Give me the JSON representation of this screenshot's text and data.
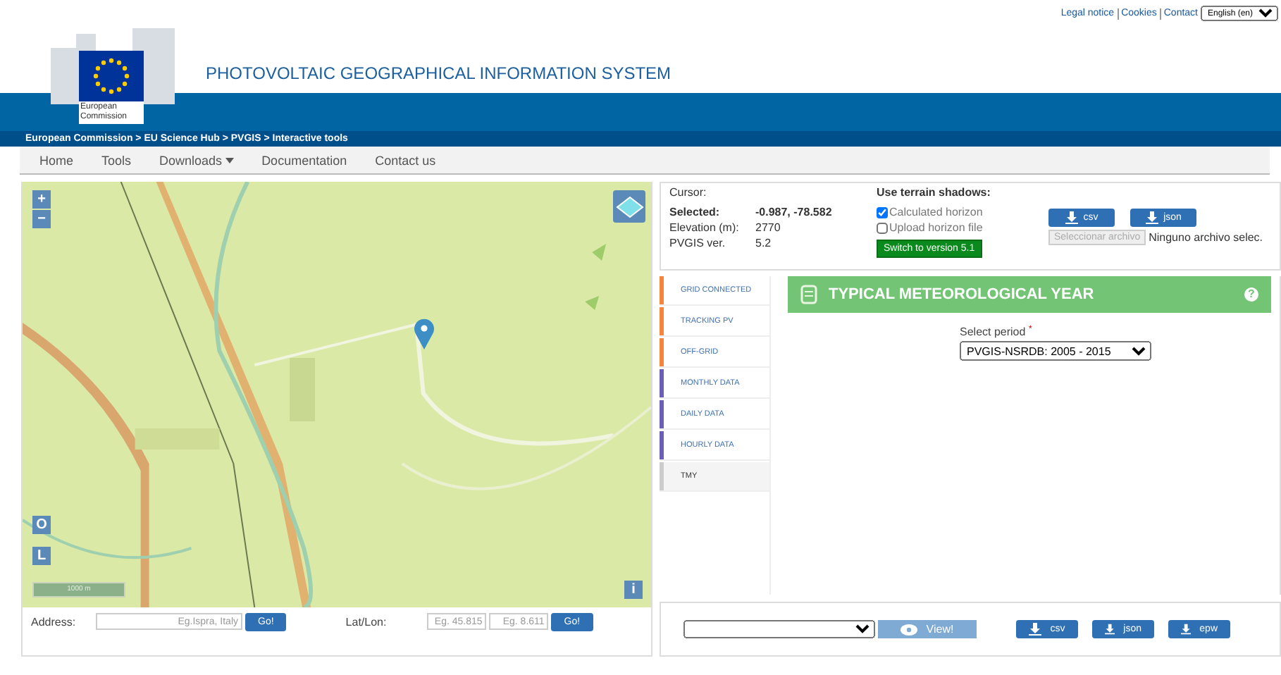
{
  "top_links": [
    "Legal notice",
    "Cookies",
    "Contact"
  ],
  "language": "English (en)",
  "logo": {
    "line1": "European",
    "line2": "Commission"
  },
  "site_title": "PHOTOVOLTAIC GEOGRAPHICAL INFORMATION SYSTEM",
  "breadcrumb": "European Commission > EU Science Hub > PVGIS > Interactive tools",
  "nav": [
    {
      "label": "Home",
      "dropdown": false
    },
    {
      "label": "Tools",
      "dropdown": false
    },
    {
      "label": "Downloads",
      "dropdown": true
    },
    {
      "label": "Documentation",
      "dropdown": false
    },
    {
      "label": "Contact us",
      "dropdown": false
    }
  ],
  "map": {
    "zoom_in": "+",
    "zoom_out": "−",
    "o_button": "O",
    "l_button": "L",
    "info_button": "i",
    "scale": "1000 m"
  },
  "address_bar": {
    "address_label": "Address:",
    "address_placeholder": "Eg.Ispra, Italy",
    "go": "Go!",
    "latlon_label": "Lat/Lon:",
    "lat_placeholder": "Eg. 45.815",
    "lon_placeholder": "Eg. 8.611",
    "go2": "Go!"
  },
  "info": {
    "cursor_label": "Cursor:",
    "rows": [
      {
        "label": "Selected:",
        "value": "-0.987, -78.582",
        "bold": true
      },
      {
        "label": "Elevation (m):",
        "value": "2770",
        "bold": false
      },
      {
        "label": "PVGIS ver.",
        "value": "5.2",
        "bold": false
      }
    ],
    "shadows_title": "Use terrain shadows:",
    "options": [
      {
        "label": "Calculated horizon",
        "checked": true
      },
      {
        "label": "Upload horizon file",
        "checked": false
      }
    ],
    "switch_button": "Switch to version 5.1",
    "csv": "csv",
    "json": "json",
    "file_button": "Seleccionar archivo",
    "file_status": "Ninguno archivo selec."
  },
  "tabs": [
    {
      "label": "GRID CONNECTED",
      "color": "#f5843c",
      "selected": false
    },
    {
      "label": "TRACKING PV",
      "color": "#f5843c",
      "selected": false
    },
    {
      "label": "OFF-GRID",
      "color": "#f5843c",
      "selected": false
    },
    {
      "label": "MONTHLY DATA",
      "color": "#6a5fb5",
      "selected": false
    },
    {
      "label": "DAILY DATA",
      "color": "#6a5fb5",
      "selected": false
    },
    {
      "label": "HOURLY DATA",
      "color": "#6a5fb5",
      "selected": false
    },
    {
      "label": "TMY",
      "color": "#cccccc",
      "selected": true
    }
  ],
  "panel": {
    "title": "TYPICAL METEOROLOGICAL YEAR",
    "help": "?",
    "period_label": "Select period",
    "required": "*",
    "period_value": "PVGIS-NSRDB: 2005 - 2015"
  },
  "bottom": {
    "view": "View!",
    "downloads": [
      "csv",
      "json",
      "epw"
    ]
  }
}
